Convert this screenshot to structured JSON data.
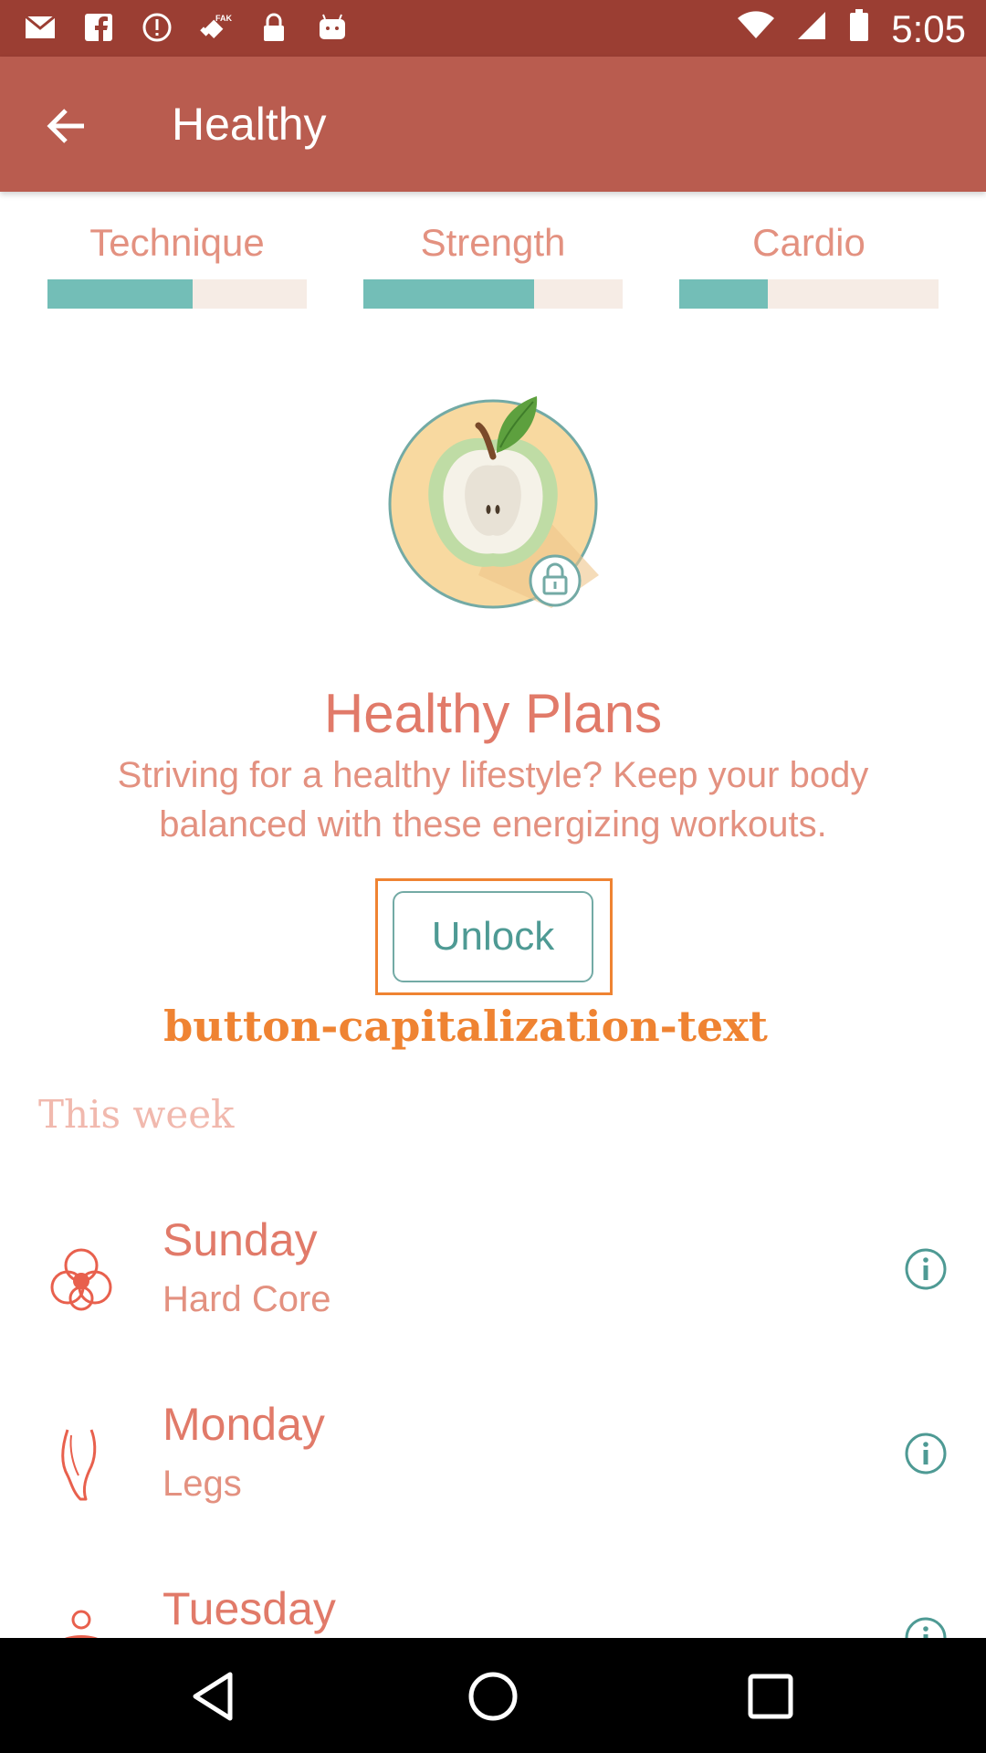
{
  "status_bar": {
    "time": "5:05",
    "icons": [
      "mail-icon",
      "facebook-icon",
      "alert-icon",
      "fake-gps-icon",
      "lock-icon",
      "android-icon",
      "wifi-icon",
      "signal-icon",
      "battery-icon"
    ]
  },
  "app_bar": {
    "title": "Healthy",
    "back_icon": "arrow-back-icon"
  },
  "tabs": [
    {
      "label": "Technique",
      "progress": 0.56
    },
    {
      "label": "Strength",
      "progress": 0.66
    },
    {
      "label": "Cardio",
      "progress": 0.34
    }
  ],
  "plan": {
    "title": "Healthy Plans",
    "description": "Striving for a healthy lifestyle? Keep your body balanced with these energizing workouts.",
    "unlock_label": "Unlock",
    "annotation": "button-capitalization-text"
  },
  "week": {
    "heading": "This week",
    "items": [
      {
        "day": "Sunday",
        "workout": "Hard Core",
        "icon": "core-icon"
      },
      {
        "day": "Monday",
        "workout": "Legs",
        "icon": "leg-icon"
      },
      {
        "day": "Tuesday",
        "workout": "",
        "icon": "body-icon"
      }
    ]
  },
  "nav_bar": {
    "icons": [
      "back-triangle-icon",
      "home-circle-icon",
      "recents-square-icon"
    ]
  },
  "colors": {
    "status_bar": "#9b3e33",
    "app_bar": "#b95c4f",
    "accent_text": "#e17a69",
    "progress_fill": "#73beb7",
    "progress_track": "#f6ece5",
    "teal": "#4e9a94",
    "annotation": "#ef8332"
  }
}
